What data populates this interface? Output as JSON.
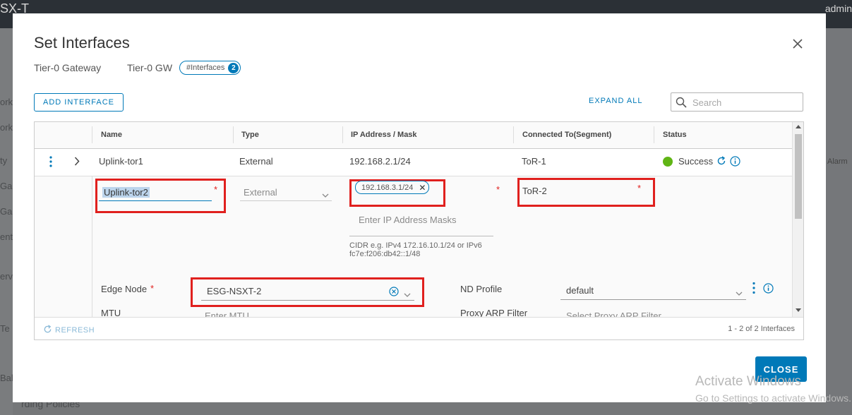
{
  "background": {
    "app_brand": "SX-T",
    "user": "admin",
    "left_nav": [
      "ork",
      "ork",
      "ty",
      "Ga",
      "Ga",
      "ent",
      "ervi",
      "Te",
      "Bal"
    ],
    "bottom_text": "rding Policies",
    "right_text": "Alarm"
  },
  "modal": {
    "title": "Set Interfaces",
    "breadcrumb": {
      "gateway_label": "Tier-0 Gateway",
      "gateway_name": "Tier-0 GW",
      "pill_label": "#Interfaces",
      "pill_count": "2"
    },
    "toolbar": {
      "add_label": "ADD INTERFACE",
      "expand_label": "EXPAND ALL",
      "search_placeholder": "Search"
    },
    "grid": {
      "columns": [
        "Name",
        "Type",
        "IP Address / Mask",
        "Connected To(Segment)",
        "Status"
      ],
      "rows": [
        {
          "name": "Uplink-tor1",
          "type": "External",
          "ip": "192.168.2.1/24",
          "segment": "ToR-1",
          "status": "Success"
        }
      ],
      "edit": {
        "name_value": "Uplink-tor2",
        "type_value": "External",
        "ip_chip": "192.168.3.1/24",
        "ip_placeholder": "Enter IP Address Masks",
        "ip_hint_line1": "CIDR e.g. IPv4 172.16.10.1/24 or IPv6",
        "ip_hint_line2": "fc7e:f206:db42::1/48",
        "segment_value": "ToR-2",
        "edge_node_label": "Edge Node",
        "edge_node_value": "ESG-NSXT-2",
        "nd_profile_label": "ND Profile",
        "nd_profile_value": "default",
        "mtu_label": "MTU",
        "mtu_placeholder": "Enter MTU",
        "proxy_arp_label": "Proxy ARP Filter",
        "proxy_arp_placeholder": "Select Proxy ARP Filter"
      },
      "footer": {
        "refresh_label": "REFRESH",
        "count_label": "1 - 2 of 2 Interfaces"
      }
    },
    "close_label": "CLOSE"
  },
  "watermark": {
    "line1": "Activate Windows",
    "line2": "Go to Settings to activate Windows."
  },
  "colors": {
    "accent": "#0079b8",
    "success": "#60b515",
    "highlight": "#e0201e"
  }
}
